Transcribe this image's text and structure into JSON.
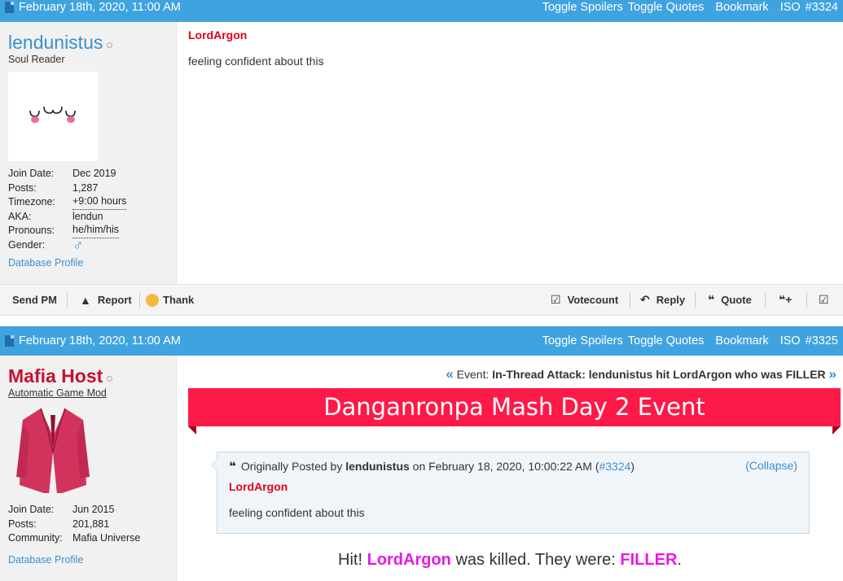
{
  "posts": [
    {
      "date": "February 18th, 2020, 11:00 AM",
      "links": {
        "toggle_spoilers": "Toggle Spoilers",
        "toggle_quotes": "Toggle Quotes",
        "bookmark": "Bookmark",
        "iso": "ISO",
        "post_number": "#3324"
      },
      "user": {
        "name": "lendunistus",
        "title": "Soul Reader",
        "info": [
          {
            "k": "Join Date:",
            "v": "Dec 2019"
          },
          {
            "k": "Posts:",
            "v": "1,287"
          },
          {
            "k": "Timezone:",
            "v": "+9:00 hours"
          },
          {
            "k": "AKA:",
            "v": "lendun"
          },
          {
            "k": "Pronouns:",
            "v": "he/him/his"
          },
          {
            "k": "Gender:",
            "v": "♂"
          }
        ],
        "profile_link": "Database Profile"
      },
      "body": {
        "author": "LordArgon",
        "text": "feeling confident about this"
      }
    },
    {
      "date": "February 18th, 2020, 11:00 AM",
      "links": {
        "toggle_spoilers": "Toggle Spoilers",
        "toggle_quotes": "Toggle Quotes",
        "bookmark": "Bookmark",
        "iso": "ISO",
        "post_number": "#3325"
      },
      "user": {
        "name": "Mafia Host",
        "title": "Automatic Game Mod",
        "info": [
          {
            "k": "Join Date:",
            "v": "Jun 2015"
          },
          {
            "k": "Posts:",
            "v": "201,881"
          },
          {
            "k": "Community:",
            "v": "Mafia Universe"
          }
        ],
        "profile_link": "Database Profile"
      },
      "event": {
        "prefix": "Event:",
        "text": "In-Thread Attack: lendunistus hit LordArgon who was FILLER",
        "banner": "Danganronpa Mash Day 2 Event"
      },
      "quote": {
        "prefix": "Originally Posted by",
        "author": "lendunistus",
        "on": "on February 18, 2020, 10:00:22 AM (",
        "ref": "#3324",
        "close": ")",
        "collapse": "(Collapse)",
        "inner_author": "LordArgon",
        "inner_text": "feeling confident about this"
      },
      "result": {
        "hit": "Hit!",
        "victim": "LordArgon",
        "mid": "was killed. They were:",
        "role": "FILLER",
        "end": "."
      }
    }
  ],
  "actions": {
    "send_pm": "Send PM",
    "report": "Report",
    "thank": "Thank",
    "votecount": "Votecount",
    "reply": "Reply",
    "quote": "Quote"
  }
}
